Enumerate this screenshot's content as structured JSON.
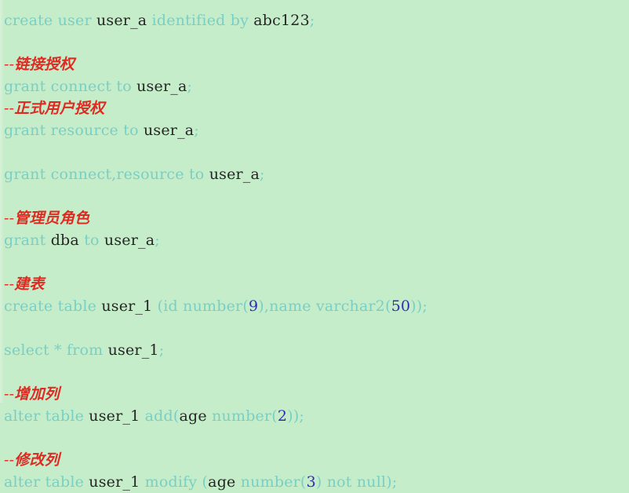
{
  "editor": {
    "name": "sql-code-snippet",
    "background_color": "#c6edca",
    "language": "SQL",
    "colors": {
      "keyword": "#79cfc4",
      "identifier": "#262626",
      "number": "#2d2db4",
      "comment": "#dd2b22"
    }
  },
  "lines": [
    {
      "index": 0,
      "type": "code",
      "text": "create user user_a identified by abc123;",
      "tokens": [
        {
          "t": "create user ",
          "c": "kw"
        },
        {
          "t": "user_a",
          "c": "id"
        },
        {
          "t": " identified by ",
          "c": "kw"
        },
        {
          "t": "abc123",
          "c": "id"
        },
        {
          "t": ";",
          "c": "kw"
        }
      ]
    },
    {
      "index": 1,
      "type": "blank",
      "text": "",
      "tokens": []
    },
    {
      "index": 2,
      "type": "comment",
      "text": "--链接授权",
      "tokens": [
        {
          "t": "--",
          "c": "cmt-dash"
        },
        {
          "t": "链接授权",
          "c": "cmt"
        }
      ]
    },
    {
      "index": 3,
      "type": "code",
      "text": "grant connect to user_a;",
      "tokens": [
        {
          "t": "grant connect to ",
          "c": "kw"
        },
        {
          "t": "user_a",
          "c": "id"
        },
        {
          "t": ";",
          "c": "kw"
        }
      ]
    },
    {
      "index": 4,
      "type": "comment",
      "text": "--正式用户授权",
      "tokens": [
        {
          "t": "--",
          "c": "cmt-dash"
        },
        {
          "t": "正式用户授权",
          "c": "cmt"
        }
      ]
    },
    {
      "index": 5,
      "type": "code",
      "text": "grant resource to user_a;",
      "tokens": [
        {
          "t": "grant resource to ",
          "c": "kw"
        },
        {
          "t": "user_a",
          "c": "id"
        },
        {
          "t": ";",
          "c": "kw"
        }
      ]
    },
    {
      "index": 6,
      "type": "blank",
      "text": "",
      "tokens": []
    },
    {
      "index": 7,
      "type": "code",
      "text": "grant connect,resource to user_a;",
      "tokens": [
        {
          "t": "grant connect,resource to ",
          "c": "kw"
        },
        {
          "t": "user_a",
          "c": "id"
        },
        {
          "t": ";",
          "c": "kw"
        }
      ]
    },
    {
      "index": 8,
      "type": "blank",
      "text": "",
      "tokens": []
    },
    {
      "index": 9,
      "type": "comment",
      "text": "--管理员角色",
      "tokens": [
        {
          "t": "--",
          "c": "cmt-dash"
        },
        {
          "t": "管理员角色",
          "c": "cmt"
        }
      ]
    },
    {
      "index": 10,
      "type": "code",
      "text": "grant dba to user_a;",
      "tokens": [
        {
          "t": "grant ",
          "c": "kw"
        },
        {
          "t": "dba",
          "c": "id"
        },
        {
          "t": " to ",
          "c": "kw"
        },
        {
          "t": "user_a",
          "c": "id"
        },
        {
          "t": ";",
          "c": "kw"
        }
      ]
    },
    {
      "index": 11,
      "type": "blank",
      "text": "",
      "tokens": []
    },
    {
      "index": 12,
      "type": "comment",
      "text": "--建表",
      "tokens": [
        {
          "t": "--",
          "c": "cmt-dash"
        },
        {
          "t": "建表",
          "c": "cmt"
        }
      ]
    },
    {
      "index": 13,
      "type": "code",
      "text": "create table user_1 (id number(9),name varchar2(50));",
      "tokens": [
        {
          "t": "create table ",
          "c": "kw"
        },
        {
          "t": "user_1",
          "c": "id"
        },
        {
          "t": " (id number(",
          "c": "kw"
        },
        {
          "t": "9",
          "c": "num"
        },
        {
          "t": "),name varchar2(",
          "c": "kw"
        },
        {
          "t": "50",
          "c": "num"
        },
        {
          "t": "));",
          "c": "kw"
        }
      ]
    },
    {
      "index": 14,
      "type": "blank",
      "text": "",
      "tokens": []
    },
    {
      "index": 15,
      "type": "code",
      "text": "select * from user_1;",
      "tokens": [
        {
          "t": "select * from ",
          "c": "kw"
        },
        {
          "t": "user_1",
          "c": "id"
        },
        {
          "t": ";",
          "c": "kw"
        }
      ]
    },
    {
      "index": 16,
      "type": "blank",
      "text": "",
      "tokens": []
    },
    {
      "index": 17,
      "type": "comment",
      "text": "--增加列",
      "tokens": [
        {
          "t": "--",
          "c": "cmt-dash"
        },
        {
          "t": "增加列",
          "c": "cmt"
        }
      ]
    },
    {
      "index": 18,
      "type": "code",
      "text": "alter table user_1 add(age number(2));",
      "tokens": [
        {
          "t": "alter table ",
          "c": "kw"
        },
        {
          "t": "user_1",
          "c": "id"
        },
        {
          "t": " add(",
          "c": "kw"
        },
        {
          "t": "age",
          "c": "id"
        },
        {
          "t": " number(",
          "c": "kw"
        },
        {
          "t": "2",
          "c": "num"
        },
        {
          "t": "));",
          "c": "kw"
        }
      ]
    },
    {
      "index": 19,
      "type": "blank",
      "text": "",
      "tokens": []
    },
    {
      "index": 20,
      "type": "comment",
      "text": "--修改列",
      "tokens": [
        {
          "t": "--",
          "c": "cmt-dash"
        },
        {
          "t": "修改列",
          "c": "cmt"
        }
      ]
    },
    {
      "index": 21,
      "type": "code",
      "text": "alter table user_1 modify (age number(3) not null);",
      "tokens": [
        {
          "t": "alter table ",
          "c": "kw"
        },
        {
          "t": "user_1",
          "c": "id"
        },
        {
          "t": " modify (",
          "c": "kw"
        },
        {
          "t": "age",
          "c": "id"
        },
        {
          "t": " number(",
          "c": "kw"
        },
        {
          "t": "3",
          "c": "num"
        },
        {
          "t": ") not null);",
          "c": "kw"
        }
      ]
    }
  ]
}
